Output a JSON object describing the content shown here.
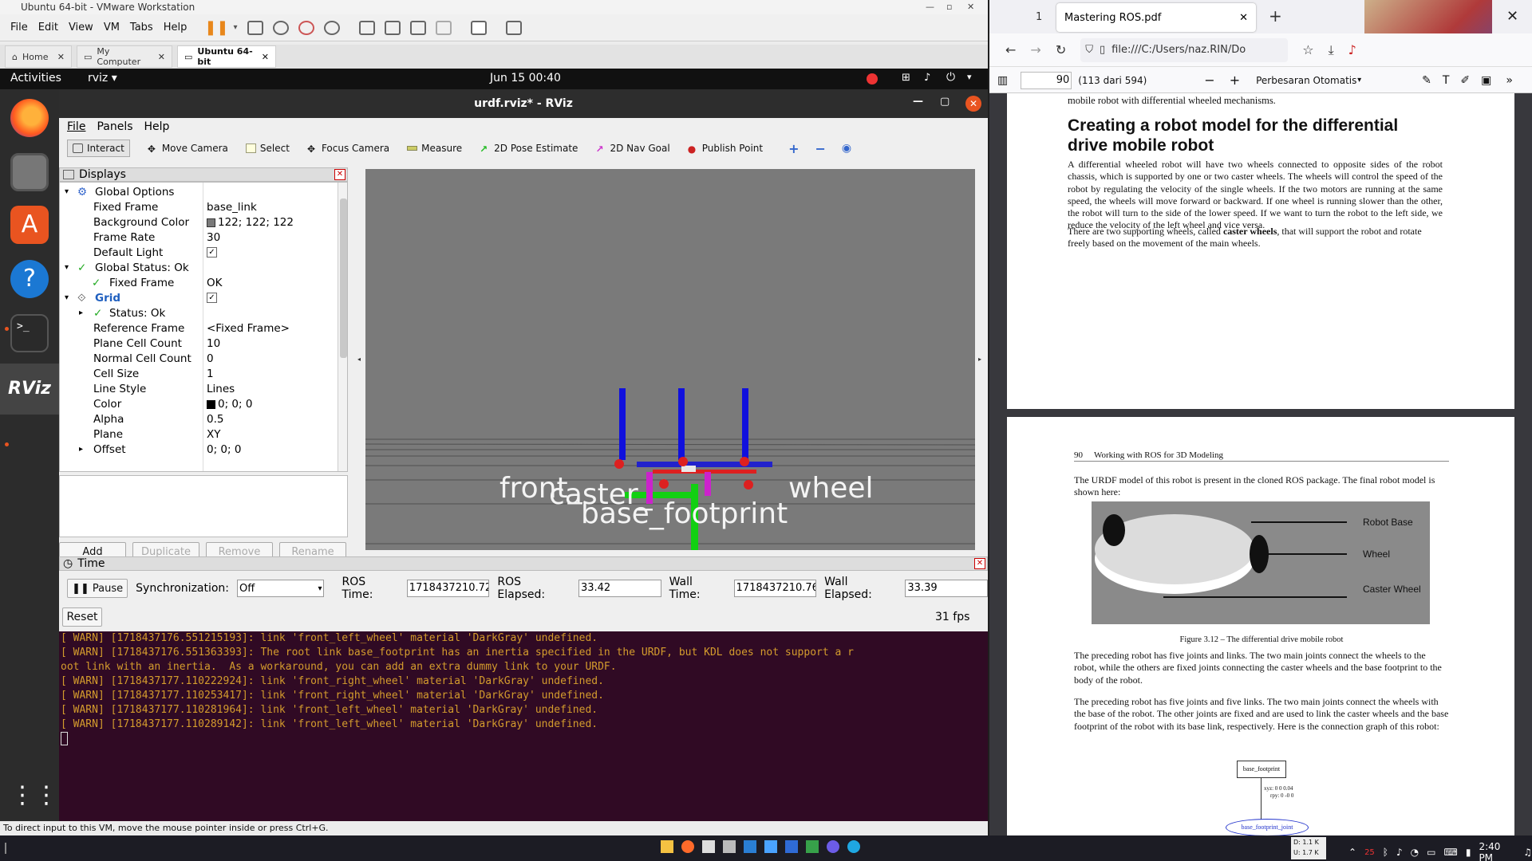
{
  "vmware": {
    "title": "Ubuntu 64-bit - VMware Workstation",
    "menu": [
      "File",
      "Edit",
      "View",
      "VM",
      "Tabs",
      "Help"
    ],
    "tabs": [
      "Home",
      "My Computer",
      "Ubuntu 64-bit"
    ],
    "status": "To direct input to this VM, move the mouse pointer inside or press Ctrl+G."
  },
  "ubuntu": {
    "activities": "Activities",
    "app": "rviz",
    "clock": "Jun 15  00:40"
  },
  "rviz": {
    "title": "urdf.rviz* - RViz",
    "menu": [
      "File",
      "Panels",
      "Help"
    ],
    "tools": [
      "Interact",
      "Move Camera",
      "Select",
      "Focus Camera",
      "Measure",
      "2D Pose Estimate",
      "2D Nav Goal",
      "Publish Point"
    ],
    "displays_title": "Displays",
    "rows": [
      {
        "k": "Global Options",
        "v": ""
      },
      {
        "k": "Fixed Frame",
        "v": "base_link"
      },
      {
        "k": "Background Color",
        "v": "122; 122; 122"
      },
      {
        "k": "Frame Rate",
        "v": "30"
      },
      {
        "k": "Default Light",
        "v": "✓"
      },
      {
        "k": "Global Status: Ok",
        "v": ""
      },
      {
        "k": "Fixed Frame",
        "v": "OK"
      },
      {
        "k": "Grid",
        "v": "✓"
      },
      {
        "k": "Status: Ok",
        "v": ""
      },
      {
        "k": "Reference Frame",
        "v": "<Fixed Frame>"
      },
      {
        "k": "Plane Cell Count",
        "v": "10"
      },
      {
        "k": "Normal Cell Count",
        "v": "0"
      },
      {
        "k": "Cell Size",
        "v": "1"
      },
      {
        "k": "Line Style",
        "v": "Lines"
      },
      {
        "k": "Color",
        "v": "0; 0; 0"
      },
      {
        "k": "Alpha",
        "v": "0.5"
      },
      {
        "k": "Plane",
        "v": "XY"
      },
      {
        "k": "Offset",
        "v": "0; 0; 0"
      }
    ],
    "buttons": [
      "Add",
      "Duplicate",
      "Remove",
      "Rename"
    ],
    "labels3d": {
      "front": "front_",
      "wheel": "wheel",
      "caster": "caster_",
      "base": "base_footprint"
    },
    "time": {
      "title": "Time",
      "pause": "Pause",
      "sync_label": "Synchronization:",
      "sync_value": "Off",
      "ros_time_label": "ROS Time:",
      "ros_time": "1718437210.72",
      "ros_elapsed_label": "ROS Elapsed:",
      "ros_elapsed": "33.42",
      "wall_time_label": "Wall Time:",
      "wall_time": "1718437210.76",
      "wall_elapsed_label": "Wall Elapsed:",
      "wall_elapsed": "33.39",
      "reset": "Reset",
      "fps": "31 fps"
    }
  },
  "terminal": [
    "[ WARN] [1718437176.551215193]: link 'front_left_wheel' material 'DarkGray' undefined.",
    "[ WARN] [1718437176.551363393]: The root link base_footprint has an inertia specified in the URDF, but KDL does not support a r",
    "oot link with an inertia.  As a workaround, you can add an extra dummy link to your URDF.",
    "[ WARN] [1718437177.110222924]: link 'front_right_wheel' material 'DarkGray' undefined.",
    "[ WARN] [1718437177.110253417]: link 'front_right_wheel' material 'DarkGray' undefined.",
    "[ WARN] [1718437177.110281964]: link 'front_left_wheel' material 'DarkGray' undefined.",
    "[ WARN] [1718437177.110289142]: link 'front_left_wheel' material 'DarkGray' undefined."
  ],
  "browser": {
    "tab_count": "1",
    "tab_title": "Mastering ROS.pdf",
    "url": "file:///C:/Users/naz.RIN/Do",
    "page": "90",
    "page_of": "(113 dari 594)",
    "zoom": "Perbesaran Otomatis",
    "page1": {
      "top_line": "mobile robot with differential wheeled mechanisms.",
      "heading": "Creating a robot model for the differential drive mobile robot",
      "p1": "A differential wheeled robot will have two wheels connected to opposite sides of the robot chassis, which is supported by one or two caster wheels. The wheels will control the speed of the robot by regulating the velocity of the single wheels. If the two motors are running at the same speed, the wheels will move forward or backward. If one wheel is running slower than the other, the robot will turn to the side of the lower speed. If we want to turn the robot to the left side, we reduce the velocity of the left wheel and vice versa.",
      "p2a": "There are two supporting wheels, called ",
      "p2b": "caster wheels",
      "p2c": ", that will support the robot and rotate freely based on the movement of the main wheels."
    },
    "page2": {
      "header_num": "90",
      "header_title": "Working with ROS for 3D Modeling",
      "p1": "The URDF model of this robot is present in the cloned ROS package. The final robot model is shown here:",
      "fig_labels": [
        "Robot Base",
        "Wheel",
        "Caster Wheel"
      ],
      "caption": "Figure 3.12 – The differential drive mobile robot",
      "p2": "The preceding robot has five joints and links. The two main joints connect the wheels to the robot, while the others are fixed joints connecting the caster wheels and the base footprint to the body of the robot.",
      "p3": "The preceding robot has five joints and five links. The two main joints connect the wheels with the base of the robot. The other joints are fixed and are used to link the caster wheels and the base footprint of the robot with its base link, respectively. Here is the connection graph of this robot:",
      "graph_node": "base_footprint",
      "graph_xyz": "xyz: 0 0 0.04",
      "graph_rpy": "rpy: 0 -0 0",
      "graph_joint": "base_footprint_joint"
    }
  },
  "taskbar": {
    "net_down": "D: 1.1 K",
    "net_up": "U: 1.7 K",
    "clock": "2:40 PM",
    "badge": "25"
  }
}
